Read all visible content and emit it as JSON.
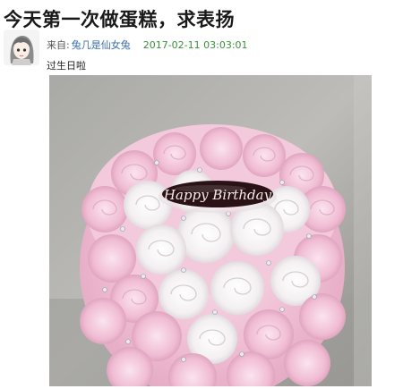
{
  "post": {
    "title": "今天第一次做蛋糕，求表扬",
    "from_label": "来自:",
    "author": "兔几是仙女兔",
    "timestamp": "2017-02-11 03:03:01",
    "caption": "过生日啦"
  },
  "photo": {
    "plaque_text": "Happy Birthday",
    "icon": "birthday-cake-photo"
  },
  "colors": {
    "author_link": "#3a6ea5",
    "timestamp": "#3b8e3b",
    "frosting_pink": "#f2c3d8",
    "plaque": "#2a1216"
  }
}
